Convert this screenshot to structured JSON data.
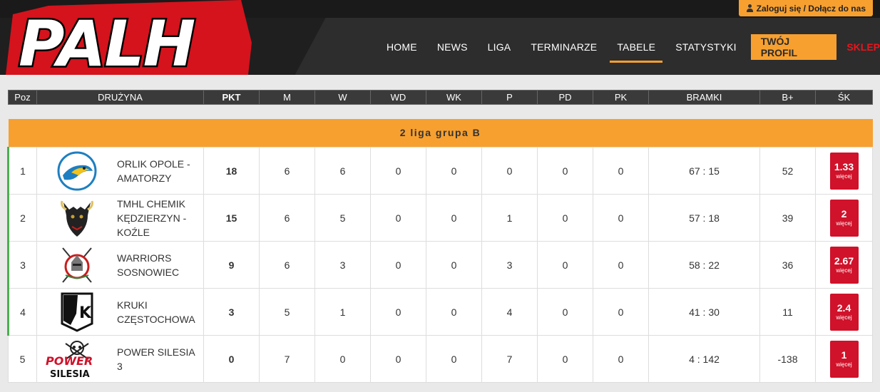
{
  "header": {
    "logo_text": "PALH",
    "login_label": "Zaloguj się / Dołącz do nas",
    "nav": [
      {
        "label": "HOME",
        "active": false
      },
      {
        "label": "NEWS",
        "active": false
      },
      {
        "label": "LIGA",
        "active": false
      },
      {
        "label": "TERMINARZE",
        "active": false
      },
      {
        "label": "TABELE",
        "active": true
      },
      {
        "label": "STATYSTYKI",
        "active": false
      }
    ],
    "profile_label": "TWÓJ PROFIL",
    "shop_label": "SKLEP"
  },
  "colors": {
    "accent": "#f7a030",
    "shop_red": "#e8161e",
    "badge_red": "#d0122a",
    "promo_green": "#4caf50",
    "header_dark": "#2d2d2d"
  },
  "table": {
    "columns": [
      "Poz",
      "DRUŻYNA",
      "PKT",
      "M",
      "W",
      "WD",
      "WK",
      "P",
      "PD",
      "PK",
      "BRAMKI",
      "B+",
      "ŚK"
    ],
    "group_title": "2 liga grupa B",
    "sk_more_label": "więcej",
    "rows": [
      {
        "poz": "1",
        "team": "ORLIK OPOLE - AMATORZY",
        "logo": "orlik-logo",
        "pkt": "18",
        "m": "6",
        "w": "6",
        "wd": "0",
        "wk": "0",
        "p": "0",
        "pd": "0",
        "pk": "0",
        "bramki": "67 : 15",
        "bplus": "52",
        "sk": "1.33",
        "promo": true
      },
      {
        "poz": "2",
        "team": "TMHL CHEMIK KĘDZIERZYN - KOŹLE",
        "logo": "chemik-logo",
        "pkt": "15",
        "m": "6",
        "w": "5",
        "wd": "0",
        "wk": "0",
        "p": "1",
        "pd": "0",
        "pk": "0",
        "bramki": "57 : 18",
        "bplus": "39",
        "sk": "2",
        "promo": true
      },
      {
        "poz": "3",
        "team": "WARRIORS SOSNOWIEC",
        "logo": "warriors-logo",
        "pkt": "9",
        "m": "6",
        "w": "3",
        "wd": "0",
        "wk": "0",
        "p": "3",
        "pd": "0",
        "pk": "0",
        "bramki": "58 : 22",
        "bplus": "36",
        "sk": "2.67",
        "promo": true
      },
      {
        "poz": "4",
        "team": "KRUKI CZĘSTOCHOWA",
        "logo": "kruki-logo",
        "pkt": "3",
        "m": "5",
        "w": "1",
        "wd": "0",
        "wk": "0",
        "p": "4",
        "pd": "0",
        "pk": "0",
        "bramki": "41 : 30",
        "bplus": "11",
        "sk": "2.4",
        "promo": true
      },
      {
        "poz": "5",
        "team": "POWER SILESIA 3",
        "logo": "power-silesia-logo",
        "pkt": "0",
        "m": "7",
        "w": "0",
        "wd": "0",
        "wk": "0",
        "p": "7",
        "pd": "0",
        "pk": "0",
        "bramki": "4 : 142",
        "bplus": "-138",
        "sk": "1",
        "promo": false
      }
    ]
  }
}
